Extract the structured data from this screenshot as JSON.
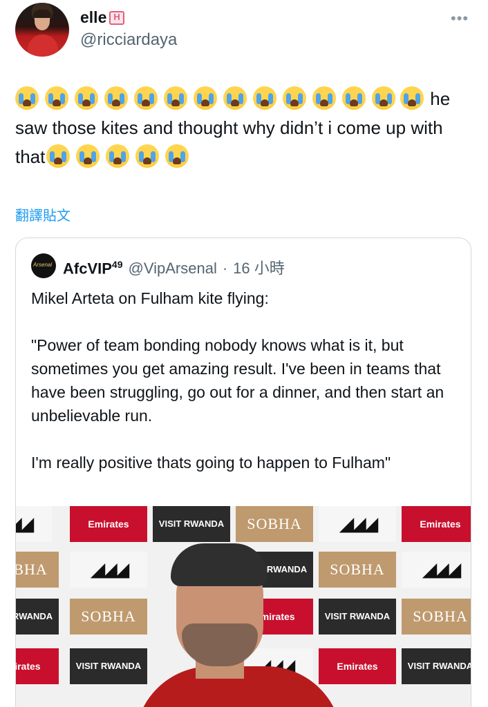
{
  "tweet": {
    "display_name": "elle",
    "handle": "@ricciardaya",
    "text_part": "he saw those kites and thought why didn’t i come up with that",
    "translate_label": "翻譯貼文"
  },
  "icons": {
    "more": "more-dots-icon",
    "emoji": "loudly-crying-face",
    "badge": "hotel-emoji"
  },
  "quoted": {
    "name": "AfcVIP",
    "name_sup": "49",
    "handle": "@VipArsenal",
    "sep": "·",
    "time": "16 小時",
    "text": "Mikel Arteta on Fulham kite flying:\n\n\"Power of team bonding nobody knows what is it, but sometimes you get amazing result. I've been in teams that have been struggling, go out for a dinner, and then start an unbelievable run.\n\nI'm really positive thats going to happen to Fulham\"",
    "media": {
      "sponsors": {
        "emirates": "Emirates",
        "visit_rwanda": "VISIT RWANDA",
        "sobha": "SOBHA"
      }
    }
  },
  "colors": {
    "link": "#1d9bf0",
    "secondary_text": "#536471",
    "border": "#cfd9de"
  }
}
